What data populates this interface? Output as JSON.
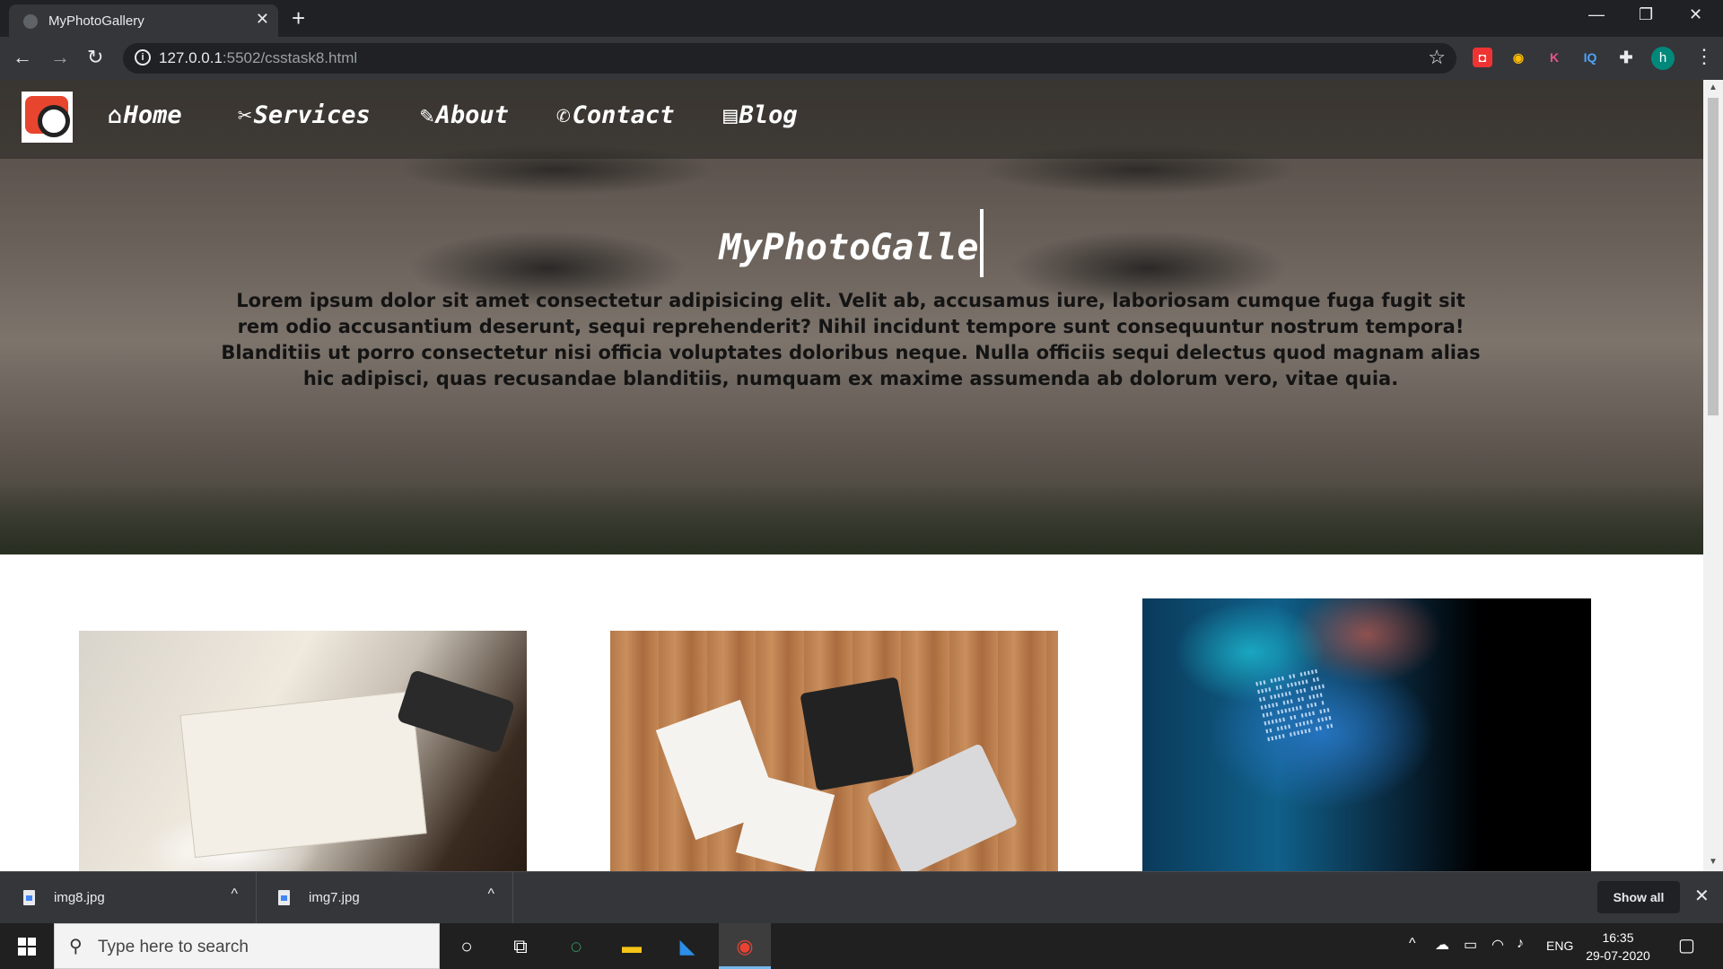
{
  "browser": {
    "tab_title": "MyPhotoGallery",
    "new_tab": "+",
    "url_host": "127.0.0.1",
    "url_path": ":5502/csstask8.html"
  },
  "nav": {
    "items": [
      {
        "label": "Home",
        "icon": "home-icon",
        "glyph": "⌂"
      },
      {
        "label": "Services",
        "icon": "tools-icon",
        "glyph": "✂"
      },
      {
        "label": "About",
        "icon": "pin-icon",
        "glyph": "✎"
      },
      {
        "label": "Contact",
        "icon": "phone-icon",
        "glyph": "✆"
      },
      {
        "label": "Blog",
        "icon": "document-icon",
        "glyph": "▤"
      }
    ]
  },
  "hero": {
    "title": "MyPhotoGalle",
    "text": "Lorem ipsum dolor sit amet consectetur adipisicing elit. Velit ab, accusamus iure, laboriosam cumque fuga fugit sit rem odio accusantium deserunt, sequi reprehenderit? Nihil incidunt tempore sunt consequuntur nostrum tempora! Blanditiis ut porro consectetur nisi officia voluptates doloribus neque. Nulla officiis sequi delectus quod magnam alias hic adipisci, quas recusandae blanditiis, numquam ex maxime assumenda ab dolorum vero, vitae quia."
  },
  "downloads": {
    "items": [
      {
        "name": "img8.jpg"
      },
      {
        "name": "img7.jpg"
      }
    ],
    "show_all": "Show all"
  },
  "taskbar": {
    "search_placeholder": "Type here to search",
    "language": "ENG",
    "time": "16:35",
    "date": "29-07-2020"
  },
  "colors": {
    "chrome_dark": "#202124",
    "chrome_toolbar": "#35363a",
    "logo_red": "#e8452e",
    "avatar": "#00897b"
  }
}
